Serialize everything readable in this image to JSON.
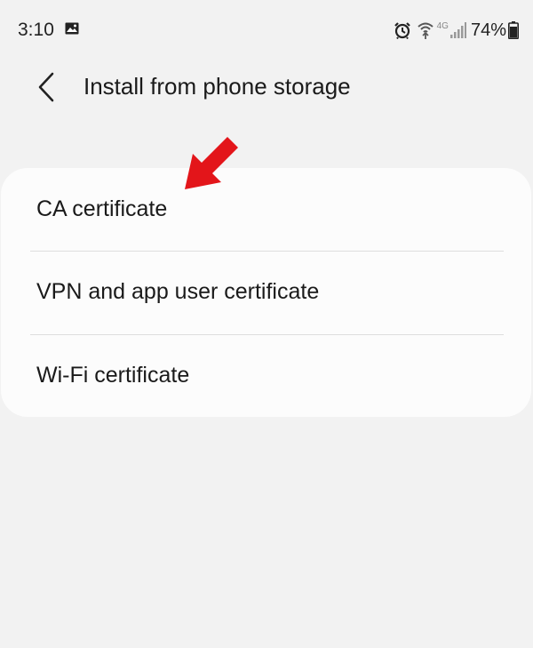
{
  "status_bar": {
    "time": "3:10",
    "battery_percent": "74%",
    "network_type": "4G",
    "icons": [
      "image-icon",
      "alarm-icon",
      "wifi-calling-icon",
      "signal-icon",
      "battery-icon"
    ]
  },
  "header": {
    "title": "Install from phone storage",
    "back_icon": "chevron-left-icon"
  },
  "list": {
    "items": [
      {
        "label": "CA certificate"
      },
      {
        "label": "VPN and app user certificate"
      },
      {
        "label": "Wi-Fi certificate"
      }
    ]
  },
  "annotation": {
    "arrow_color": "#e3151a",
    "arrow_icon": "red-arrow-icon"
  },
  "colors": {
    "background": "#f2f2f2",
    "card": "#fcfcfc",
    "divider": "#dedede",
    "text": "#1a1a1a"
  }
}
